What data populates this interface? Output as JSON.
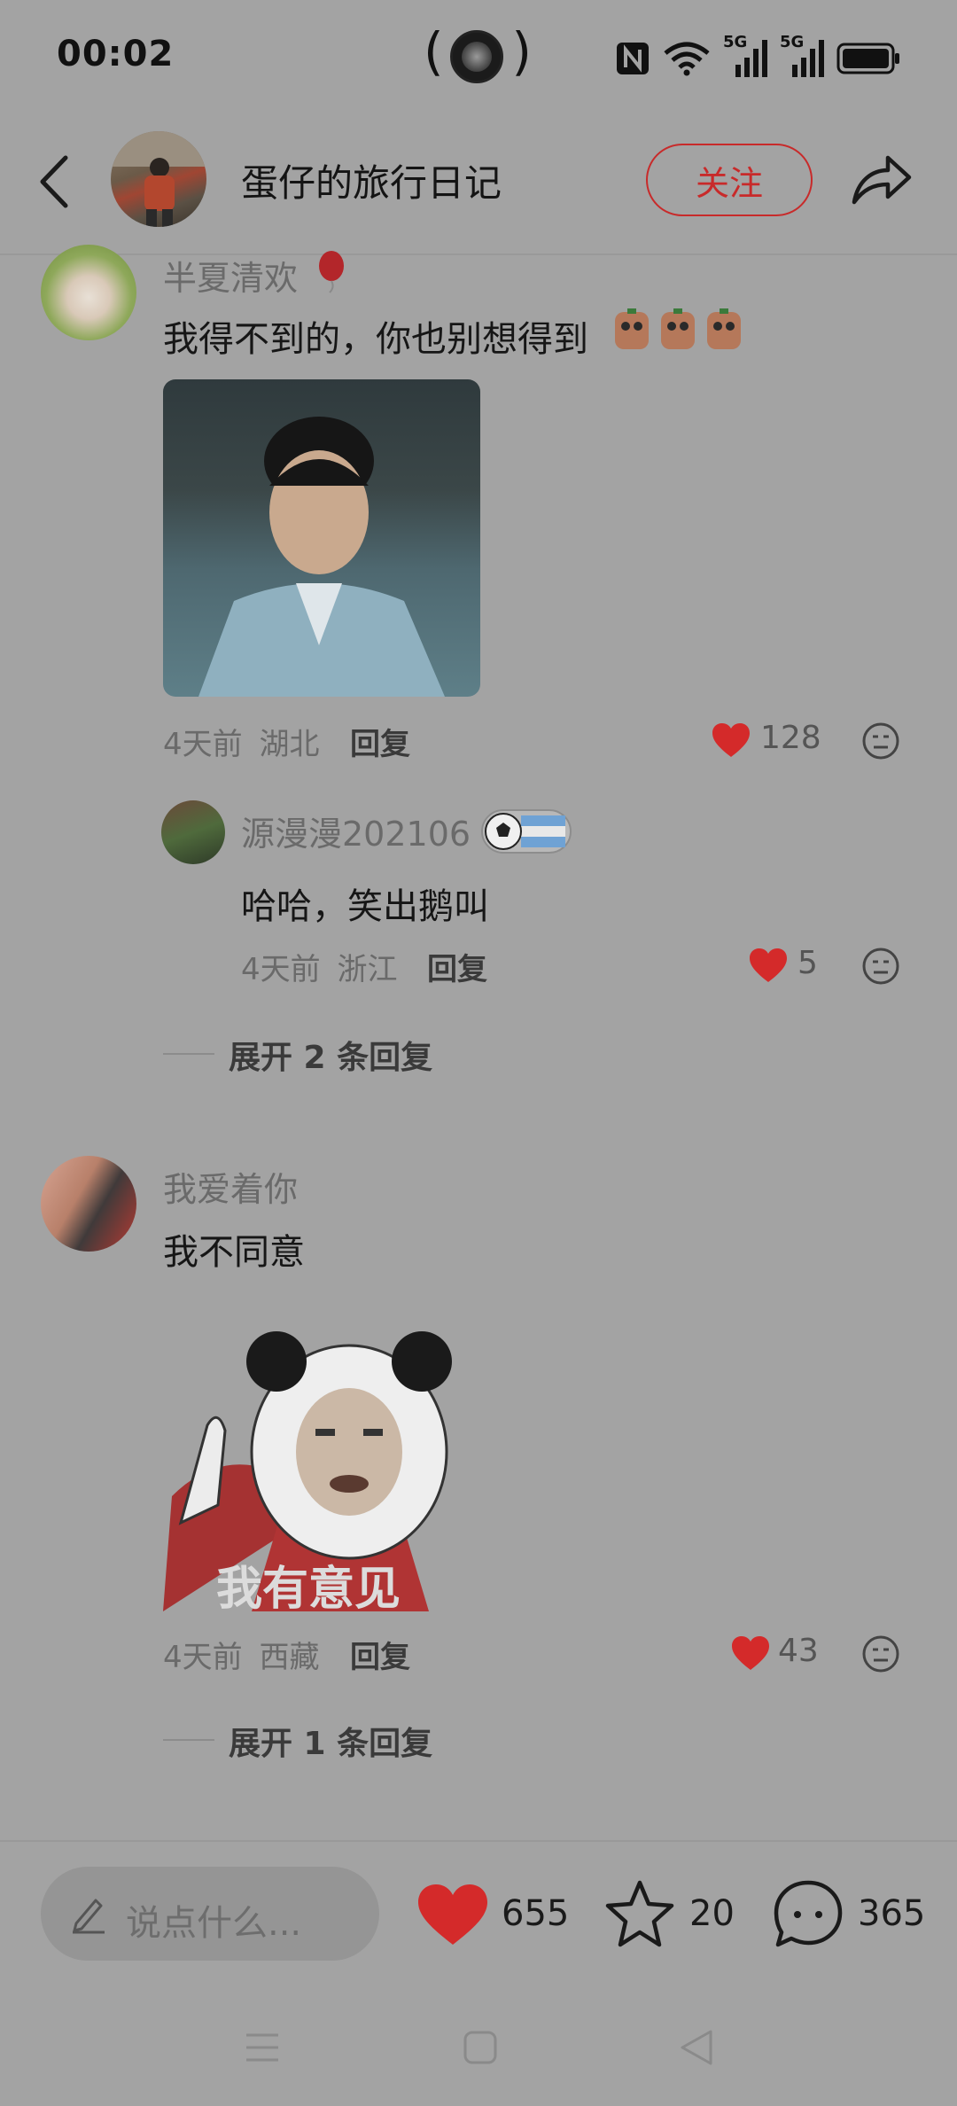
{
  "status_bar": {
    "time": "00:02",
    "network_1": "5G",
    "network_2": "5G"
  },
  "header": {
    "title": "蛋仔的旅行日记",
    "follow_label": "关注"
  },
  "comments": [
    {
      "user": "半夏清欢",
      "text": "我得不到的，你也别想得到",
      "time": "4天前",
      "location": "湖北",
      "reply_label": "回复",
      "likes": "128",
      "liked": true,
      "replies": [
        {
          "user": "源漫漫202106",
          "text": "哈哈，笑出鹅叫",
          "time": "4天前",
          "location": "浙江",
          "reply_label": "回复",
          "likes": "5",
          "liked": true
        }
      ],
      "expand_label": "展开 2 条回复"
    },
    {
      "user": "我爱着你",
      "text": "我不同意",
      "sticker_caption": "我有意见",
      "time": "4天前",
      "location": "西藏",
      "reply_label": "回复",
      "likes": "43",
      "liked": true,
      "expand_label": "展开 1 条回复"
    }
  ],
  "bottom_bar": {
    "input_placeholder": "说点什么...",
    "likes": "655",
    "favorites": "20",
    "comments": "365"
  },
  "colors": {
    "accent_red": "#d42a2a",
    "overlay_gray": "#a3a3a3"
  },
  "icons": [
    "back-icon",
    "share-icon",
    "heart-icon",
    "emoji-icon",
    "edit-icon",
    "star-icon",
    "comment-icon",
    "menu-icon",
    "home-icon",
    "back-triangle-icon",
    "nfc-icon",
    "wifi-icon",
    "signal-icon",
    "battery-icon"
  ]
}
